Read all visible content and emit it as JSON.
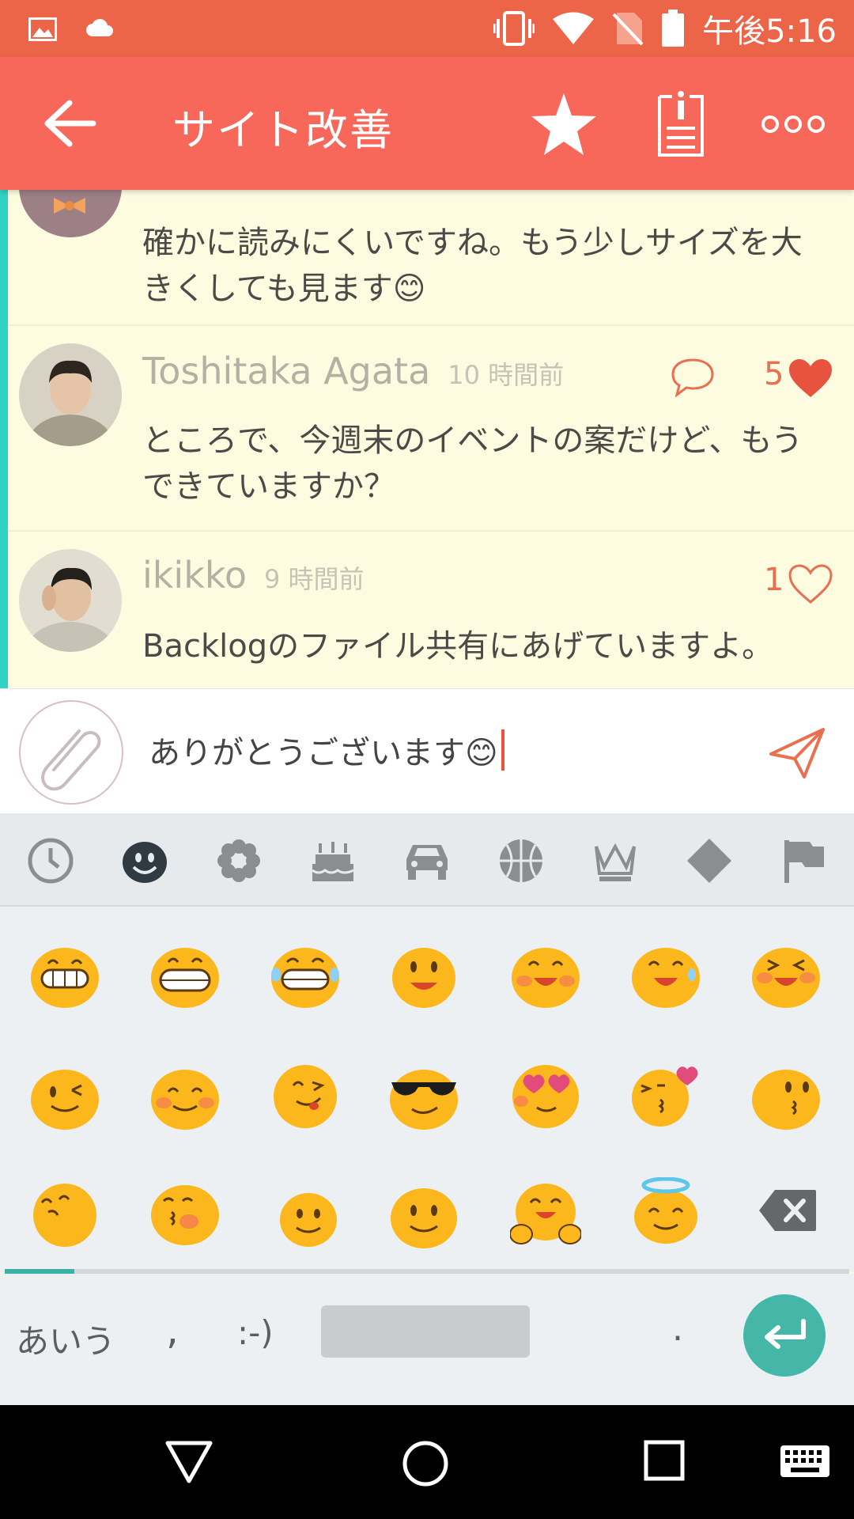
{
  "status_bar": {
    "time": "午後5:16"
  },
  "app_bar": {
    "title": "サイト改善"
  },
  "comments": [
    {
      "author": "",
      "ago": "",
      "text": "確かに読みにくいですね。もう少しサイズを大きくしても見ます😊"
    },
    {
      "author": "Toshitaka Agata",
      "ago": "10 時間前",
      "likes": "5",
      "liked": true,
      "text": "ところで、今週末のイベントの案だけど、もうできていますか？"
    },
    {
      "author": "ikikko",
      "ago": "9 時間前",
      "likes": "1",
      "liked": false,
      "text": "Backlogのファイル共有にあげていますよ。"
    }
  ],
  "composer": {
    "value": "ありがとうございます😊"
  },
  "keyboard": {
    "lang_key": "あいう",
    "comma_key": ",",
    "smiley_key": ":-)",
    "period_key": ".",
    "categories": [
      "recent-icon",
      "smiley-icon",
      "flower-icon",
      "cake-icon",
      "car-icon",
      "ball-icon",
      "crown-icon",
      "diamond-icon",
      "flag-icon"
    ],
    "selected_category": "smiley-icon"
  },
  "colors": {
    "status_bar": "#ed6548",
    "app_bar": "#f7685a",
    "accent": "#2fd3c1",
    "heart": "#e8533f"
  }
}
